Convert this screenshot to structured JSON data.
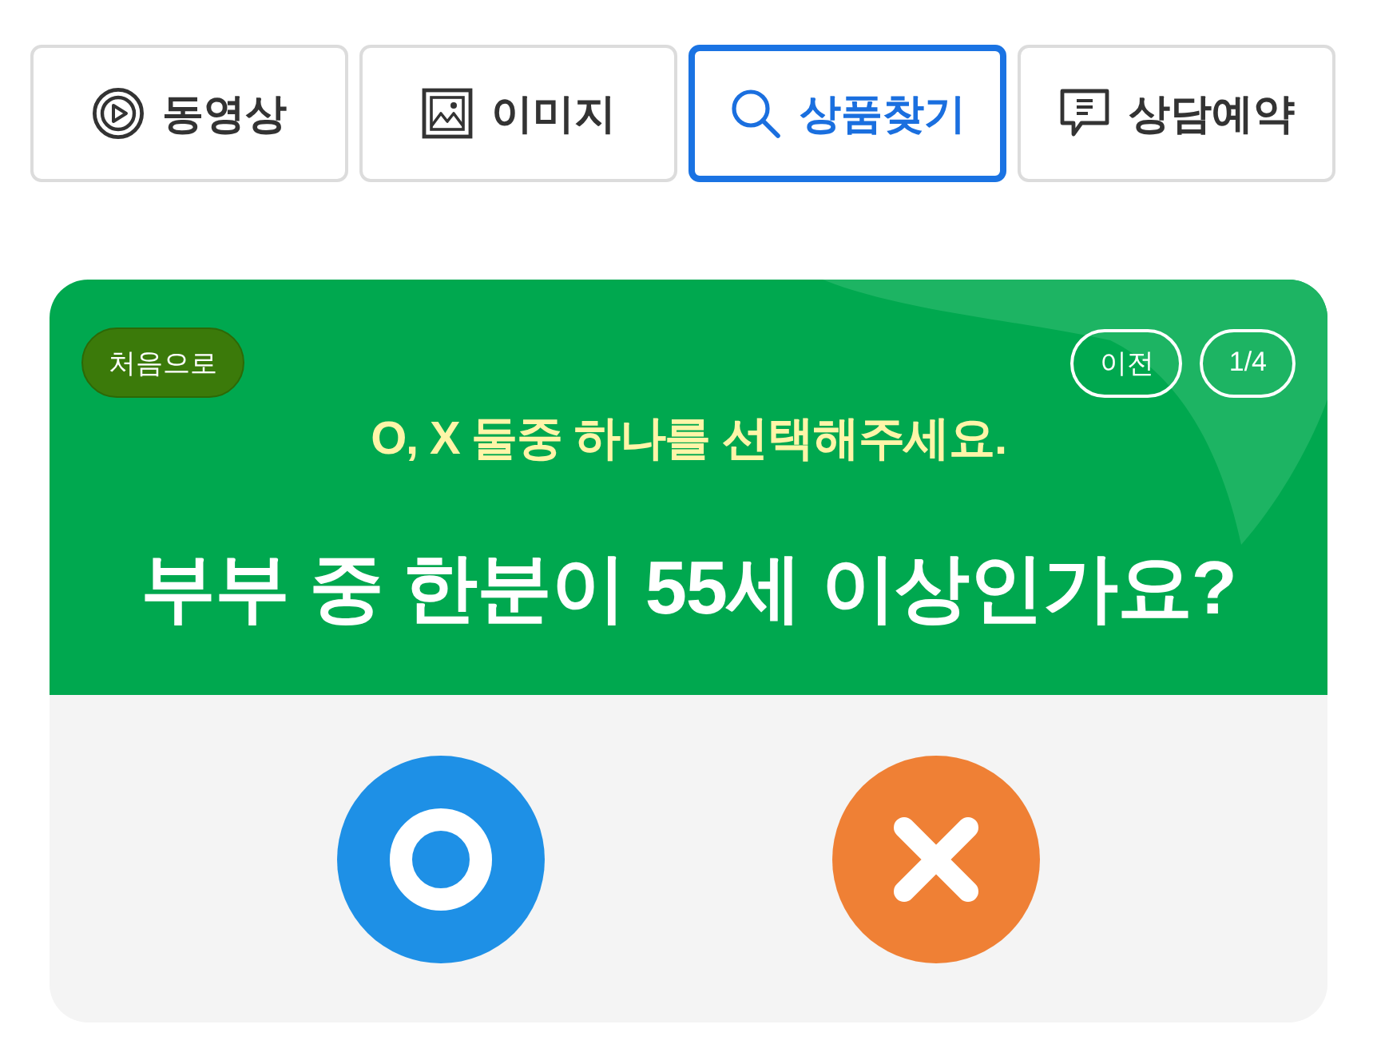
{
  "tabs": [
    {
      "label": "동영상",
      "kind": "play",
      "selected": false
    },
    {
      "label": "이미지",
      "kind": "image",
      "selected": false
    },
    {
      "label": "상품찾기",
      "kind": "search",
      "selected": true
    },
    {
      "label": "상담예약",
      "kind": "chat",
      "selected": false
    }
  ],
  "quiz": {
    "restart_button": "처음으로",
    "prev_button": "이전",
    "progress": "1/4",
    "instruction": "O, X 둘중 하나를 선택해주세요.",
    "question": "부부 중 한분이 55세 이상인가요?",
    "answers": [
      {
        "kind": "o",
        "color": "#1e90e6"
      },
      {
        "kind": "x",
        "color": "#ef8035"
      }
    ]
  }
}
